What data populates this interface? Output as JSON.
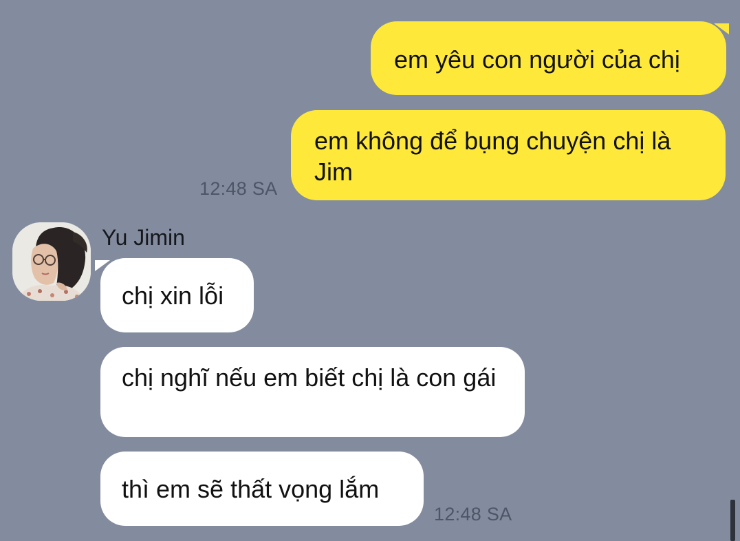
{
  "conversation": {
    "contact_name": "Yu Jimin",
    "messages": [
      {
        "direction": "outgoing",
        "text": "em yêu con người của chị"
      },
      {
        "direction": "outgoing",
        "text": "em không để bụng chuyện chị là Jim"
      },
      {
        "direction": "incoming",
        "text": "chị xin lỗi"
      },
      {
        "direction": "incoming",
        "text": "chị nghĩ nếu em biết chị là con gái"
      },
      {
        "direction": "incoming",
        "text": "thì em sẽ thất vọng lắm"
      }
    ],
    "timestamps": {
      "outgoing_group": "12:48 SA",
      "incoming_group": "12:48 SA"
    }
  },
  "colors": {
    "background": "#838c9e",
    "outgoing_bubble": "#fee93a",
    "incoming_bubble": "#ffffff",
    "timestamp_text": "#4d5566"
  },
  "icons": {
    "avatar": "profile-photo"
  }
}
